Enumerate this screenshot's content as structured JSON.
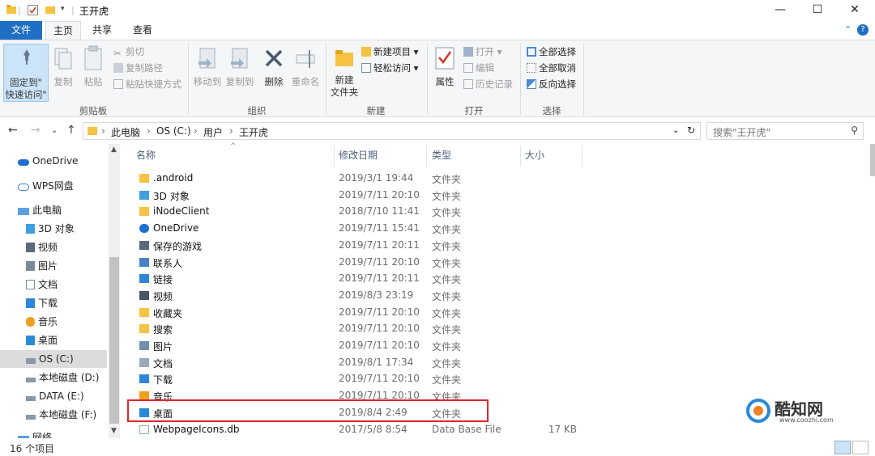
{
  "window": {
    "title": "王开虎",
    "minimize": "—",
    "maximize": "☐",
    "close": "✕"
  },
  "tabs": [
    {
      "label": "文件"
    },
    {
      "label": "主页"
    },
    {
      "label": "共享"
    },
    {
      "label": "查看"
    }
  ],
  "ribbon": {
    "clipboard": {
      "group": "剪贴板",
      "pin_line1": "固定到\"",
      "pin_line2": "快速访问\"",
      "copy": "复制",
      "paste": "粘贴",
      "cut": "剪切",
      "copy_path": "复制路径",
      "paste_shortcut": "粘贴快捷方式"
    },
    "organize": {
      "group": "组织",
      "move_to": "移动到",
      "copy_to": "复制到",
      "delete": "删除",
      "rename": "重命名"
    },
    "new": {
      "group": "新建",
      "new_folder_line1": "新建",
      "new_folder_line2": "文件夹",
      "new_item": "新建项目 ▾",
      "easy_access": "轻松访问 ▾"
    },
    "open": {
      "group": "打开",
      "properties": "属性",
      "open": "打开 ▾",
      "edit": "编辑",
      "history": "历史记录"
    },
    "select": {
      "group": "选择",
      "select_all": "全部选择",
      "select_none": "全部取消",
      "invert": "反向选择"
    }
  },
  "address": {
    "crumbs": [
      "此电脑",
      "OS (C:)",
      "用户",
      "王开虎"
    ],
    "search_placeholder": "搜索\"王开虎\""
  },
  "nav_pane": [
    {
      "label": "OneDrive",
      "icon": "cloud-icon"
    },
    {
      "label": "WPS网盘",
      "icon": "cloud-outline-icon"
    },
    {
      "label": "此电脑",
      "icon": "computer-icon"
    },
    {
      "label": "3D 对象",
      "icon": "3d-objects-icon"
    },
    {
      "label": "视频",
      "icon": "video-icon"
    },
    {
      "label": "图片",
      "icon": "pictures-icon"
    },
    {
      "label": "文档",
      "icon": "documents-icon"
    },
    {
      "label": "下载",
      "icon": "downloads-icon"
    },
    {
      "label": "音乐",
      "icon": "music-icon"
    },
    {
      "label": "桌面",
      "icon": "desktop-icon"
    },
    {
      "label": "OS (C:)",
      "icon": "drive-icon"
    },
    {
      "label": "本地磁盘 (D:)",
      "icon": "drive-icon"
    },
    {
      "label": "DATA (E:)",
      "icon": "drive-icon"
    },
    {
      "label": "本地磁盘 (F:)",
      "icon": "drive-icon"
    },
    {
      "label": "网络",
      "icon": "network-icon"
    }
  ],
  "columns": {
    "name": "名称",
    "date": "修改日期",
    "type": "类型",
    "size": "大小"
  },
  "files": [
    {
      "name": ".android",
      "date": "2019/3/1 19:44",
      "type": "文件夹",
      "size": "",
      "icon": "folder-icon"
    },
    {
      "name": "3D 对象",
      "date": "2019/7/11 20:10",
      "type": "文件夹",
      "size": "",
      "icon": "3d-objects-icon"
    },
    {
      "name": "iNodeClient",
      "date": "2018/7/10 11:41",
      "type": "文件夹",
      "size": "",
      "icon": "folder-icon"
    },
    {
      "name": "OneDrive",
      "date": "2019/7/11 15:41",
      "type": "文件夹",
      "size": "",
      "icon": "cloud-icon"
    },
    {
      "name": "保存的游戏",
      "date": "2019/7/11 20:11",
      "type": "文件夹",
      "size": "",
      "icon": "saved-games-icon"
    },
    {
      "name": "联系人",
      "date": "2019/7/11 20:10",
      "type": "文件夹",
      "size": "",
      "icon": "contacts-icon"
    },
    {
      "name": "链接",
      "date": "2019/7/11 20:11",
      "type": "文件夹",
      "size": "",
      "icon": "links-icon"
    },
    {
      "name": "视频",
      "date": "2019/8/3 23:19",
      "type": "文件夹",
      "size": "",
      "icon": "video-icon"
    },
    {
      "name": "收藏夹",
      "date": "2019/7/11 20:10",
      "type": "文件夹",
      "size": "",
      "icon": "favorites-icon"
    },
    {
      "name": "搜索",
      "date": "2019/7/11 20:10",
      "type": "文件夹",
      "size": "",
      "icon": "search-folder-icon"
    },
    {
      "name": "图片",
      "date": "2019/7/11 20:10",
      "type": "文件夹",
      "size": "",
      "icon": "pictures-icon"
    },
    {
      "name": "文档",
      "date": "2019/8/1 17:34",
      "type": "文件夹",
      "size": "",
      "icon": "documents-icon"
    },
    {
      "name": "下载",
      "date": "2019/7/11 20:10",
      "type": "文件夹",
      "size": "",
      "icon": "downloads-icon"
    },
    {
      "name": "音乐",
      "date": "2019/7/11 20:10",
      "type": "文件夹",
      "size": "",
      "icon": "music-icon"
    },
    {
      "name": "桌面",
      "date": "2019/8/4 2:49",
      "type": "文件夹",
      "size": "",
      "icon": "desktop-icon"
    },
    {
      "name": "WebpageIcons.db",
      "date": "2017/5/8 8:54",
      "type": "Data Base File",
      "size": "17 KB",
      "icon": "file-icon"
    }
  ],
  "status": {
    "count": "16 个项目"
  },
  "watermark": {
    "brand": "酷知网",
    "url": "www.coozhi.com"
  },
  "colors": {
    "accent": "#1f6fc5",
    "folder": "#f5c242",
    "highlight": "#e0262b"
  }
}
